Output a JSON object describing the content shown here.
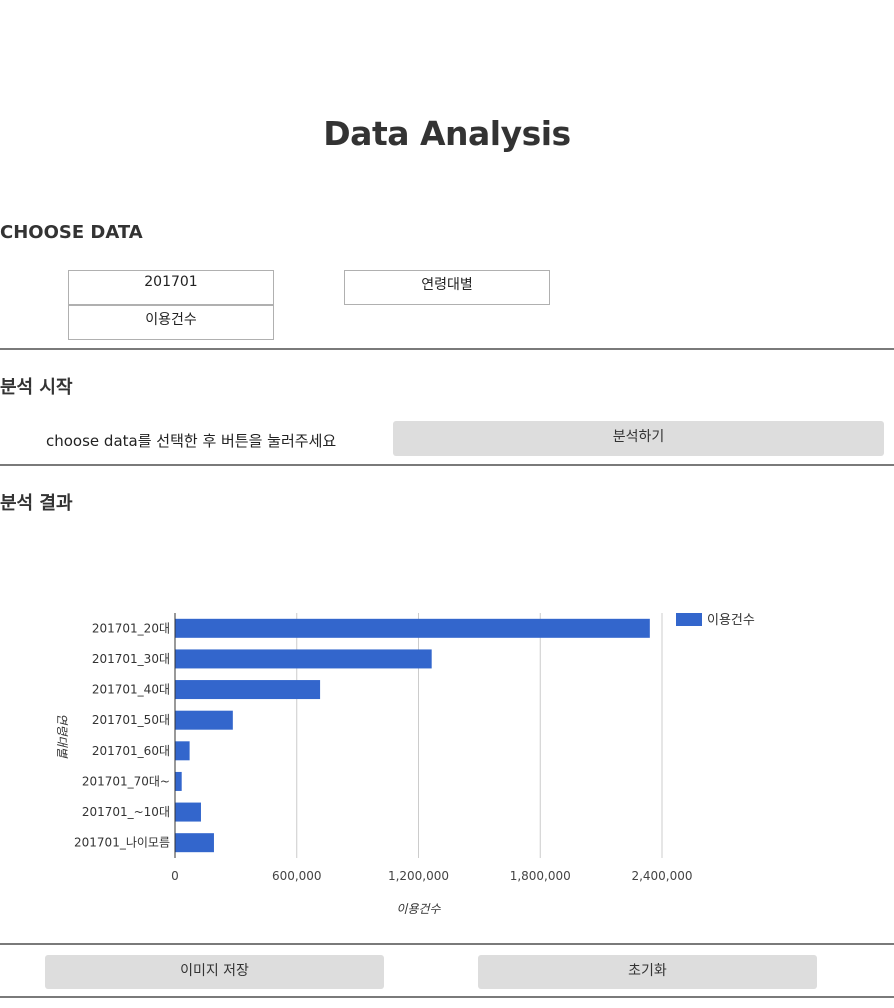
{
  "page_title": "Data Analysis",
  "choose_section": {
    "title": "CHOOSE DATA",
    "month_select": "201701",
    "category_select": "연령대별",
    "metric_select": "이용건수"
  },
  "start_section": {
    "title": "분석 시작",
    "hint": "choose data를 선택한 후 버튼을 눌러주세요",
    "analyze_button": "분석하기"
  },
  "result_section": {
    "title": "분석 결과"
  },
  "chart_data": {
    "type": "bar",
    "orientation": "horizontal",
    "categories": [
      "201701_20대",
      "201701_30대",
      "201701_40대",
      "201701_50대",
      "201701_60대",
      "201701_70대~",
      "201701_~10대",
      "201701_나이모름"
    ],
    "series": [
      {
        "name": "이용건수",
        "values": [
          2340000,
          1265000,
          715000,
          285000,
          72000,
          33000,
          128000,
          192000
        ],
        "color": "#3366cc"
      }
    ],
    "xlabel": "이용건수",
    "ylabel": "연령대별",
    "xlim": [
      0,
      2400000
    ],
    "xticks": [
      "0",
      "600,000",
      "1,200,000",
      "1,800,000",
      "2,400,000"
    ],
    "grid": true,
    "legend": "top-right"
  },
  "footer": {
    "save_image_button": "이미지 저장",
    "reset_button": "초기화"
  }
}
